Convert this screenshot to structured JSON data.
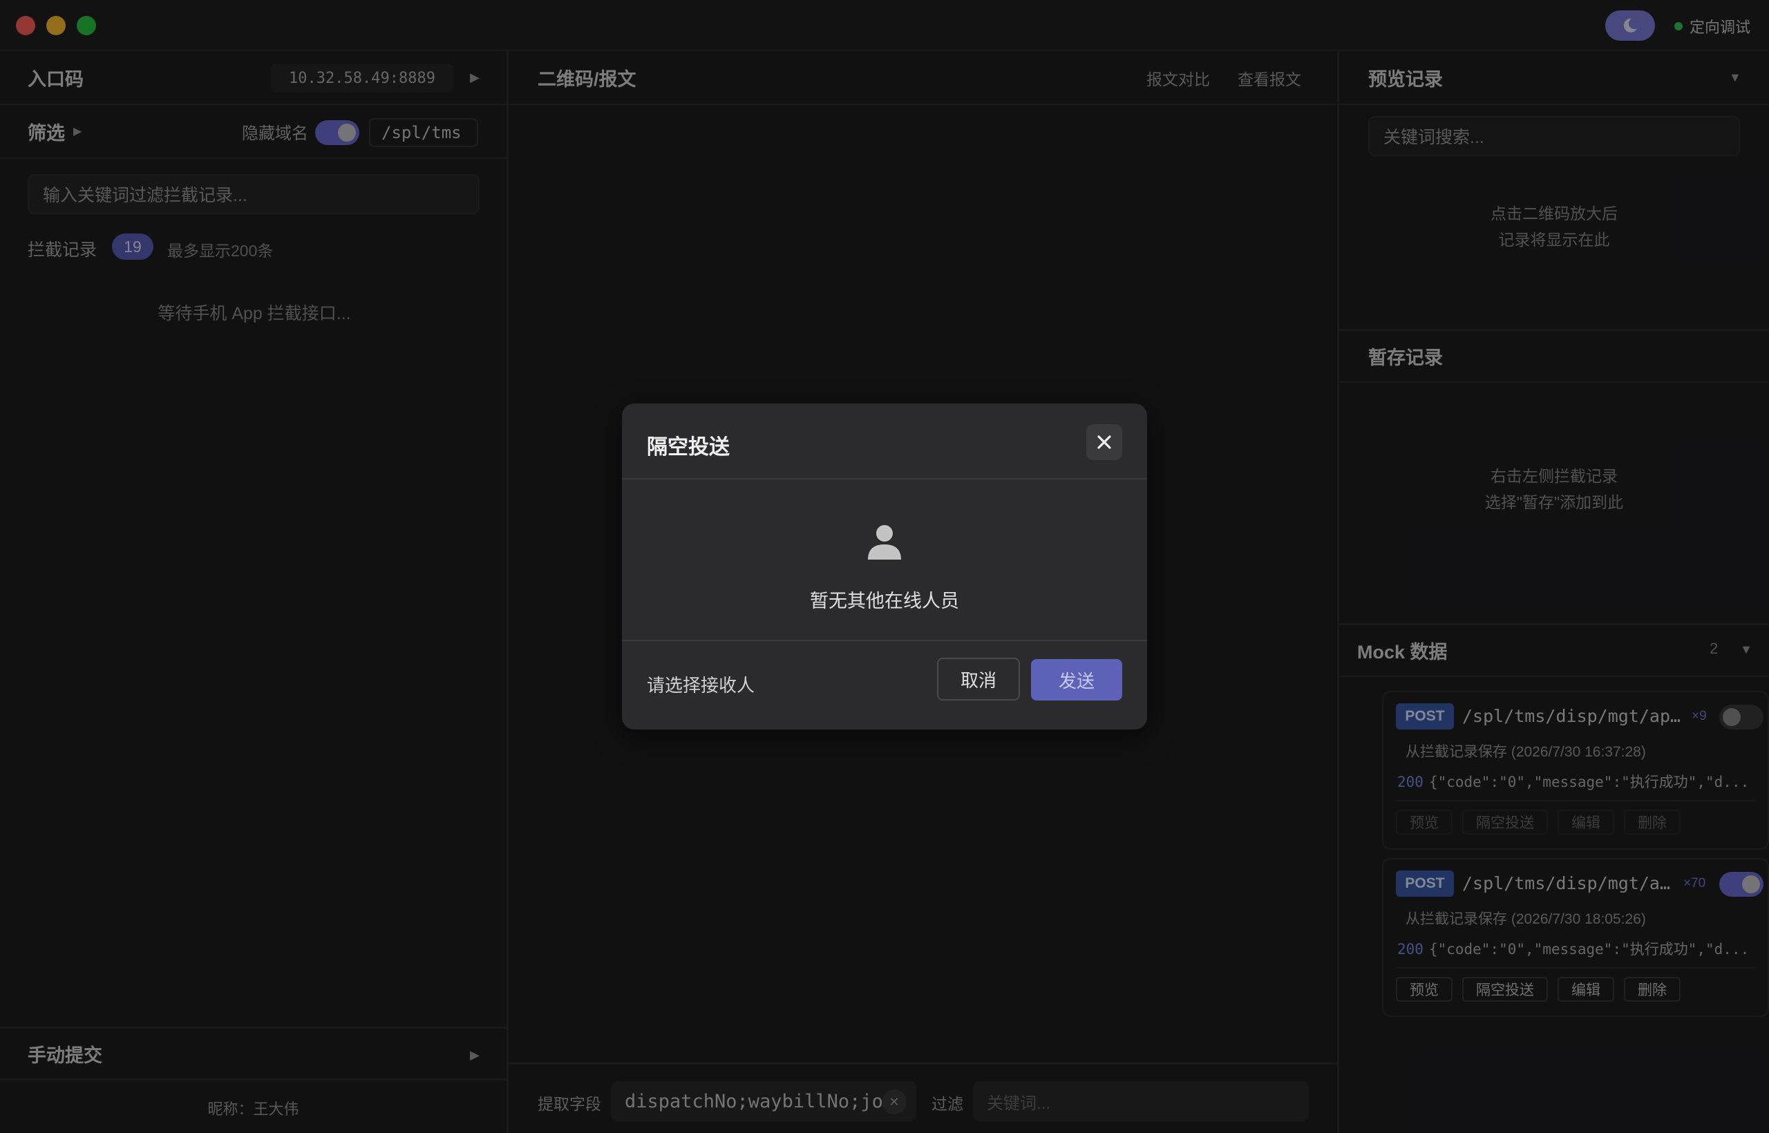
{
  "titlebar": {
    "status": "定向调试"
  },
  "left": {
    "entry_title": "入口码",
    "entry_address": "10.32.58.49:8889",
    "filter_title": "筛选",
    "hide_domain_label": "隐藏域名",
    "hide_domain_on": true,
    "path_filter": "/spl/tms",
    "search_placeholder": "输入关键词过滤拦截记录...",
    "records_label": "拦截记录",
    "records_count": "19",
    "records_max": "最多显示200条",
    "waiting_text": "等待手机 App 拦截接口...",
    "manual_submit": "手动提交",
    "nickname": "昵称：王大伟"
  },
  "middle": {
    "title": "二维码/报文",
    "compare_link": "报文对比",
    "view_link": "查看报文",
    "extract_label": "提取字段",
    "extract_value": "dispatchNo;waybillNo;jo",
    "filter_label": "过滤",
    "keyword_placeholder": "关键词..."
  },
  "right": {
    "preview_title": "预览记录",
    "preview_search_placeholder": "关键词搜索...",
    "preview_hint_1": "点击二维码放大后",
    "preview_hint_2": "记录将显示在此",
    "staged_title": "暂存记录",
    "staged_hint_1": "右击左侧拦截记录",
    "staged_hint_2": "选择\"暂存\"添加到此",
    "mock_title": "Mock 数据",
    "mock_count": "2",
    "mocks": [
      {
        "method": "POST",
        "path": "/spl/tms/disp/mgt/app...",
        "hits": "×9",
        "enabled": false,
        "source": "从拦截记录保存 (2026/7/30 16:37:28)",
        "status": "200",
        "response": "{\"code\":\"0\",\"message\":\"执行成功\",\"d...",
        "actions": [
          "预览",
          "隔空投送",
          "编辑",
          "删除"
        ]
      },
      {
        "method": "POST",
        "path": "/spl/tms/disp/mgt/ap...",
        "hits": "×70",
        "enabled": true,
        "source": "从拦截记录保存 (2026/7/30 18:05:26)",
        "status": "200",
        "response": "{\"code\":\"0\",\"message\":\"执行成功\",\"d...",
        "actions": [
          "预览",
          "隔空投送",
          "编辑",
          "删除"
        ]
      }
    ]
  },
  "modal": {
    "title": "隔空投送",
    "empty_text": "暂无其他在线人员",
    "recipient_label": "请选择接收人",
    "cancel": "取消",
    "send": "发送"
  },
  "colors": {
    "accent": "#5d62b8",
    "toggle_on": "#6a6fd6",
    "post_tag": "#3b5ba8",
    "status_online": "#34c759"
  }
}
